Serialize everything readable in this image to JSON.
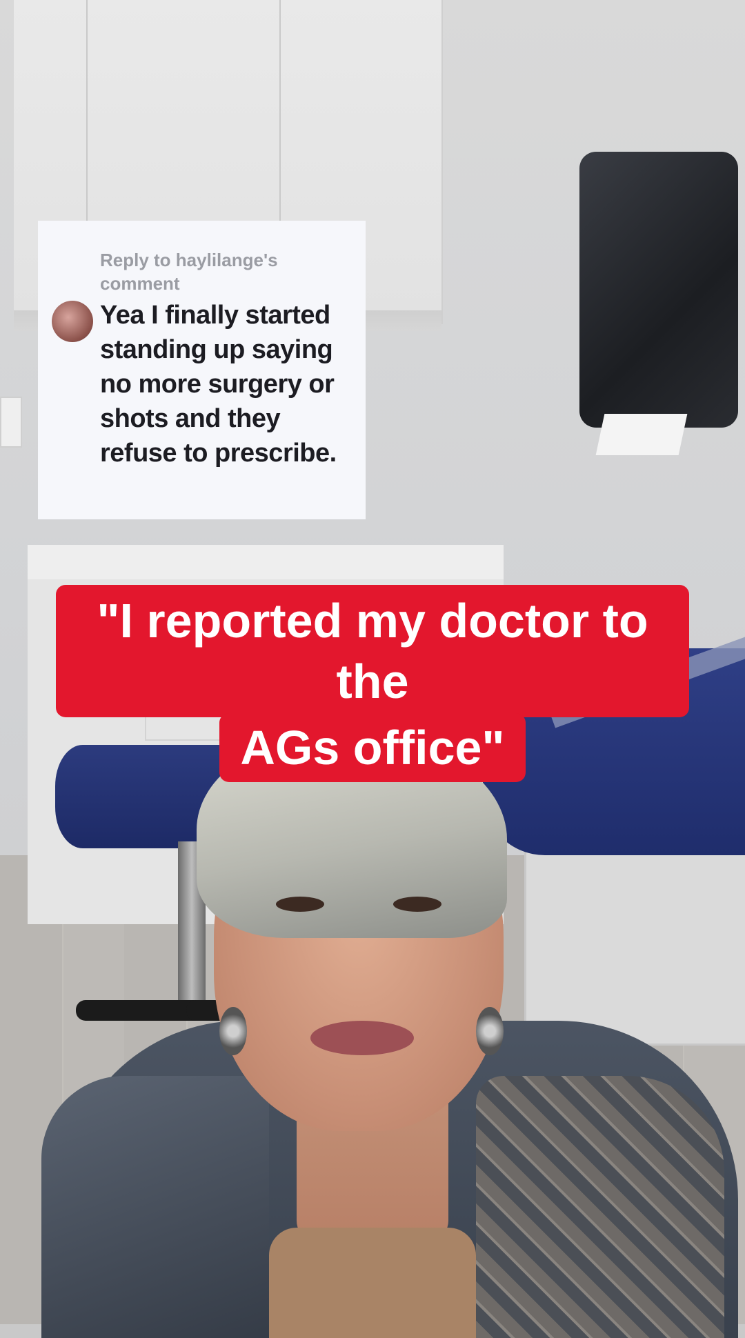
{
  "comment": {
    "reply_header": "Reply to haylilange's comment",
    "text": "Yea I finally started standing up saying no more surgery or shots and they refuse to prescribe."
  },
  "caption": {
    "line1": "\"I reported my doctor to the",
    "line2": "AGs office\""
  },
  "colors": {
    "caption_background": "#e3172d",
    "caption_text": "#ffffff",
    "comment_background": "#f6f7fb"
  }
}
